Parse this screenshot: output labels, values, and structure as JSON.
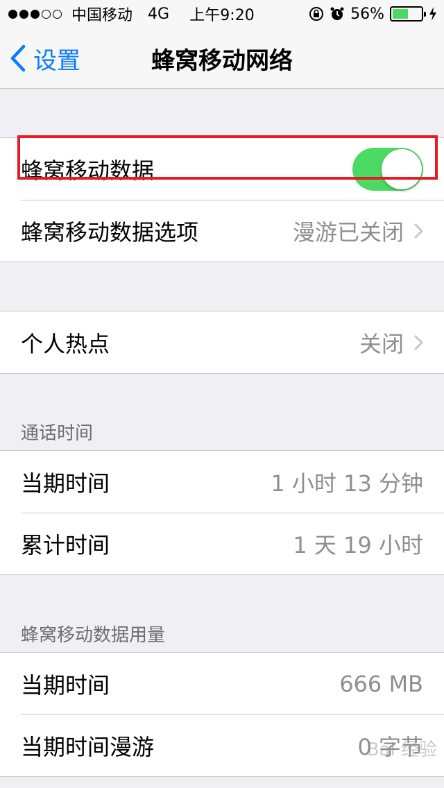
{
  "status_bar": {
    "carrier": "中国移动",
    "network": "4G",
    "time": "上午9:20",
    "battery": "56%",
    "battery_level": 0.56,
    "signal_filled": 3,
    "signal_total": 5
  },
  "nav": {
    "back_label": "设置",
    "title": "蜂窝移动网络"
  },
  "cellular_data": {
    "label": "蜂窝移动数据",
    "enabled": true
  },
  "cellular_options": {
    "label": "蜂窝移动数据选项",
    "value": "漫游已关闭"
  },
  "hotspot": {
    "label": "个人热点",
    "value": "关闭"
  },
  "call_time": {
    "header": "通话时间",
    "rows": [
      {
        "label": "当期时间",
        "value": "1 小时 13 分钟"
      },
      {
        "label": "累计时间",
        "value": "1 天 19 小时"
      }
    ]
  },
  "data_usage": {
    "header": "蜂窝移动数据用量",
    "rows": [
      {
        "label": "当期时间",
        "value": "666 MB"
      },
      {
        "label": "当期时间漫游",
        "value": "0 字节"
      }
    ]
  },
  "watermark": "Bai 经验",
  "colors": {
    "accent": "#0a7aff",
    "toggle_on": "#4cd964",
    "highlight": "#e51c23"
  }
}
